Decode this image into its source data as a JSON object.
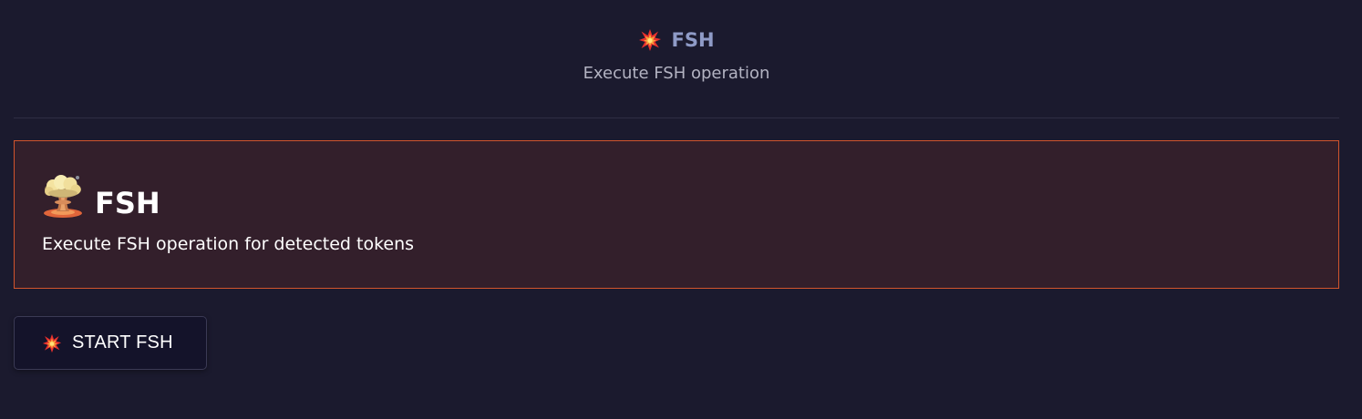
{
  "header": {
    "icon": "collision-icon",
    "title": "FSH",
    "subtitle": "Execute FSH operation"
  },
  "card": {
    "icon": "mushroom-cloud-icon",
    "title": "FSH",
    "description": "Execute FSH operation for detected tokens",
    "border_color": "#d2552d",
    "background_color": "#331f2b"
  },
  "actions": {
    "start_icon": "collision-icon",
    "start_label": "START FSH"
  },
  "theme": {
    "background": "#1b1a2e",
    "header_title_color": "#8f9bc7"
  }
}
